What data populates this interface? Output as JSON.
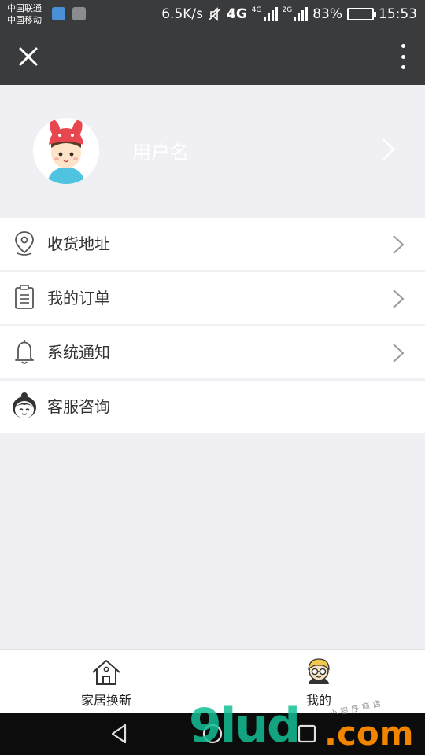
{
  "status_bar": {
    "carrier_1": "中国联通",
    "carrier_2": "中国移动",
    "speed": "6.5K/s",
    "network_1": "4G",
    "network_1_small": "4G",
    "network_2": "2G",
    "battery": "83%",
    "battery_level": 0.83,
    "time": "15:53",
    "icons": [
      "location-icon",
      "image-icon",
      "mute-icon",
      "signal-icon",
      "battery-icon"
    ]
  },
  "title_bar": {
    "icons": [
      "close-icon",
      "more-icon"
    ]
  },
  "profile": {
    "username": "用户名",
    "avatar_icon": "child-avatar-icon"
  },
  "menu": {
    "items": [
      {
        "label": "收货地址",
        "icon": "location-pin-icon",
        "has_arrow": true
      },
      {
        "label": "我的订单",
        "icon": "clipboard-icon",
        "has_arrow": true
      },
      {
        "label": "系统通知",
        "icon": "bell-icon",
        "has_arrow": true
      },
      {
        "label": "客服咨询",
        "icon": "customer-service-icon",
        "has_arrow": false
      }
    ]
  },
  "tabs": [
    {
      "label": "家居换新",
      "icon": "house-icon",
      "active": false
    },
    {
      "label": "我的",
      "icon": "user-face-icon",
      "active": true
    }
  ],
  "nav_bar": {
    "icons": [
      "back-icon",
      "home-icon",
      "recent-apps-icon"
    ]
  },
  "watermark": {
    "main": "9lud",
    "suffix": ".com",
    "small": "小程序商店"
  },
  "colors": {
    "bar_dark": "#3a3b3d",
    "background": "#efeff4",
    "battery_green": "#4cc24c",
    "avatar_hat": "#e8474f",
    "avatar_shirt": "#4fc3e0",
    "tab_face_yellow": "#f2c94c"
  }
}
